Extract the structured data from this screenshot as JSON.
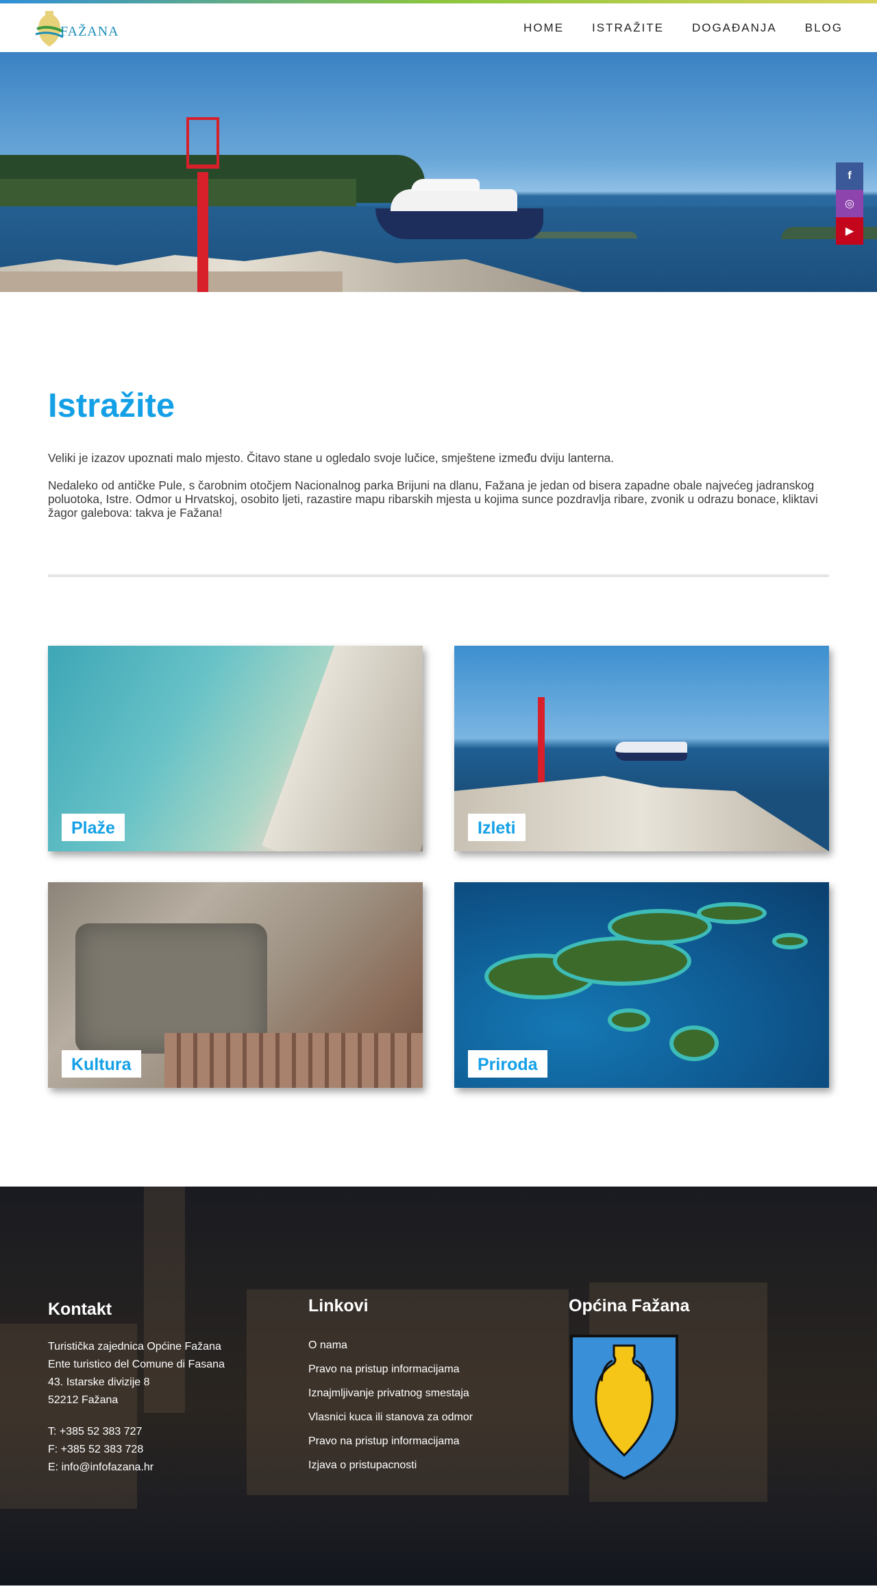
{
  "header": {
    "logo_text": "FAŽANA",
    "nav": [
      "HOME",
      "ISTRAŽITE",
      "DOGAĐANJA",
      "BLOG"
    ]
  },
  "social": {
    "facebook": "f",
    "instagram": "◎",
    "youtube": "▶"
  },
  "intro": {
    "title": "Istražite",
    "paragraph1": "Veliki je izazov upoznati malo mjesto. Čitavo stane u ogledalo svoje lučice, smještene između dviju lanterna.",
    "paragraph2": "Nedaleko od antičke Pule, s čarobnim otočjem Nacionalnog parka Brijuni na dlanu, Fažana je jedan od bisera zapadne obale najvećeg jadranskog poluotoka, Istre. Odmor u Hrvatskoj, osobito ljeti, razastire mapu ribarskih mjesta u kojima sunce pozdravlja ribare, zvonik u odrazu bonace, kliktavi žagor galebova: takva je Fažana!"
  },
  "cards": [
    {
      "label": "Plaže"
    },
    {
      "label": "Izleti"
    },
    {
      "label": "Kultura"
    },
    {
      "label": "Priroda"
    }
  ],
  "footer": {
    "contact": {
      "title": "Kontakt",
      "org1": "Turistička zajednica Općine Fažana",
      "org2": "Ente turistico del Comune di Fasana",
      "street": "43. Istarske divizije 8",
      "city": "52212 Fažana",
      "phone": "T: +385 52 383 727",
      "fax": "F: +385 52 383 728",
      "email": "E: info@infofazana.hr"
    },
    "links": {
      "title": "Linkovi",
      "items": [
        "O nama",
        "Pravo na pristup informacijama",
        "Iznajmljivanje privatnog smestaja",
        "Vlasnici kuca ili stanova za odmor",
        "Pravo na pristup informacijama",
        "Izjava o pristupacnosti"
      ]
    },
    "municipality": {
      "title": "Općina Fažana"
    }
  },
  "colors": {
    "accent": "#14a0e6",
    "crest_blue": "#3a8fd9",
    "crest_amphora": "#f5c518"
  }
}
